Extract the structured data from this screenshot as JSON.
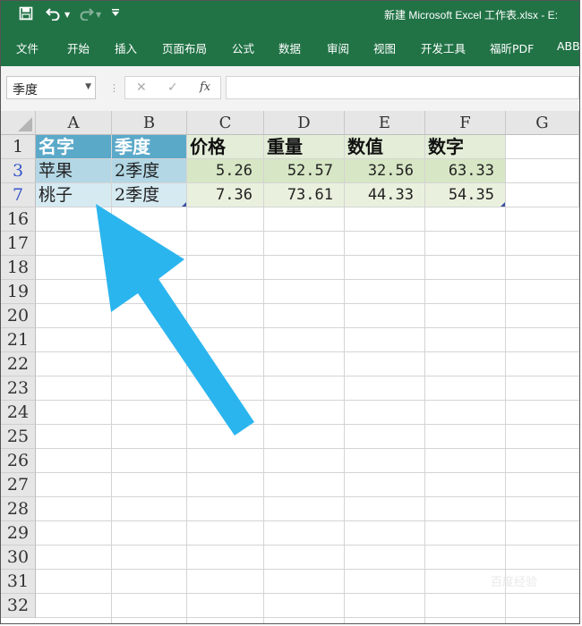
{
  "window": {
    "title": "新建 Microsoft Excel 工作表.xlsx  -  E:"
  },
  "qat": {
    "save_icon": "save-icon",
    "undo_icon": "undo-icon",
    "redo_icon": "redo-icon",
    "customize_icon": "customize-icon"
  },
  "ribbon": {
    "tabs": [
      "文件",
      "开始",
      "插入",
      "页面布局",
      "公式",
      "数据",
      "审阅",
      "视图",
      "开发工具",
      "福昕PDF",
      "ABB"
    ]
  },
  "formula_bar": {
    "name_box": "季度",
    "formula": "",
    "cancel_icon": "✕",
    "enter_icon": "✓",
    "fx_label": "fx"
  },
  "colors": {
    "ribbon_green": "#217346",
    "header_blue": "#5ba9c9",
    "row_blue": "#b3d7e5",
    "row_light_blue": "#d6eaf2",
    "header_green": "#e3edd8",
    "row_green": "#d7e7c5",
    "row_light_green": "#e9f1de",
    "arrow_blue": "#2bb5ee"
  },
  "sheet": {
    "columns": [
      "A",
      "B",
      "C",
      "D",
      "E",
      "F",
      "G"
    ],
    "rows": [
      "1",
      "3",
      "7",
      "16",
      "17",
      "18",
      "19",
      "20",
      "21",
      "22",
      "23",
      "24",
      "25",
      "26",
      "27",
      "28",
      "29",
      "30",
      "31",
      "32"
    ],
    "header_row": [
      "名字",
      "季度",
      "价格",
      "重量",
      "数值",
      "数字"
    ],
    "data_rows": [
      [
        "苹果",
        "2季度",
        "5.26",
        "52.57",
        "32.56",
        "63.33"
      ],
      [
        "桃子",
        "2季度",
        "7.36",
        "73.61",
        "44.33",
        "54.35"
      ]
    ]
  },
  "watermark": "百度经验"
}
